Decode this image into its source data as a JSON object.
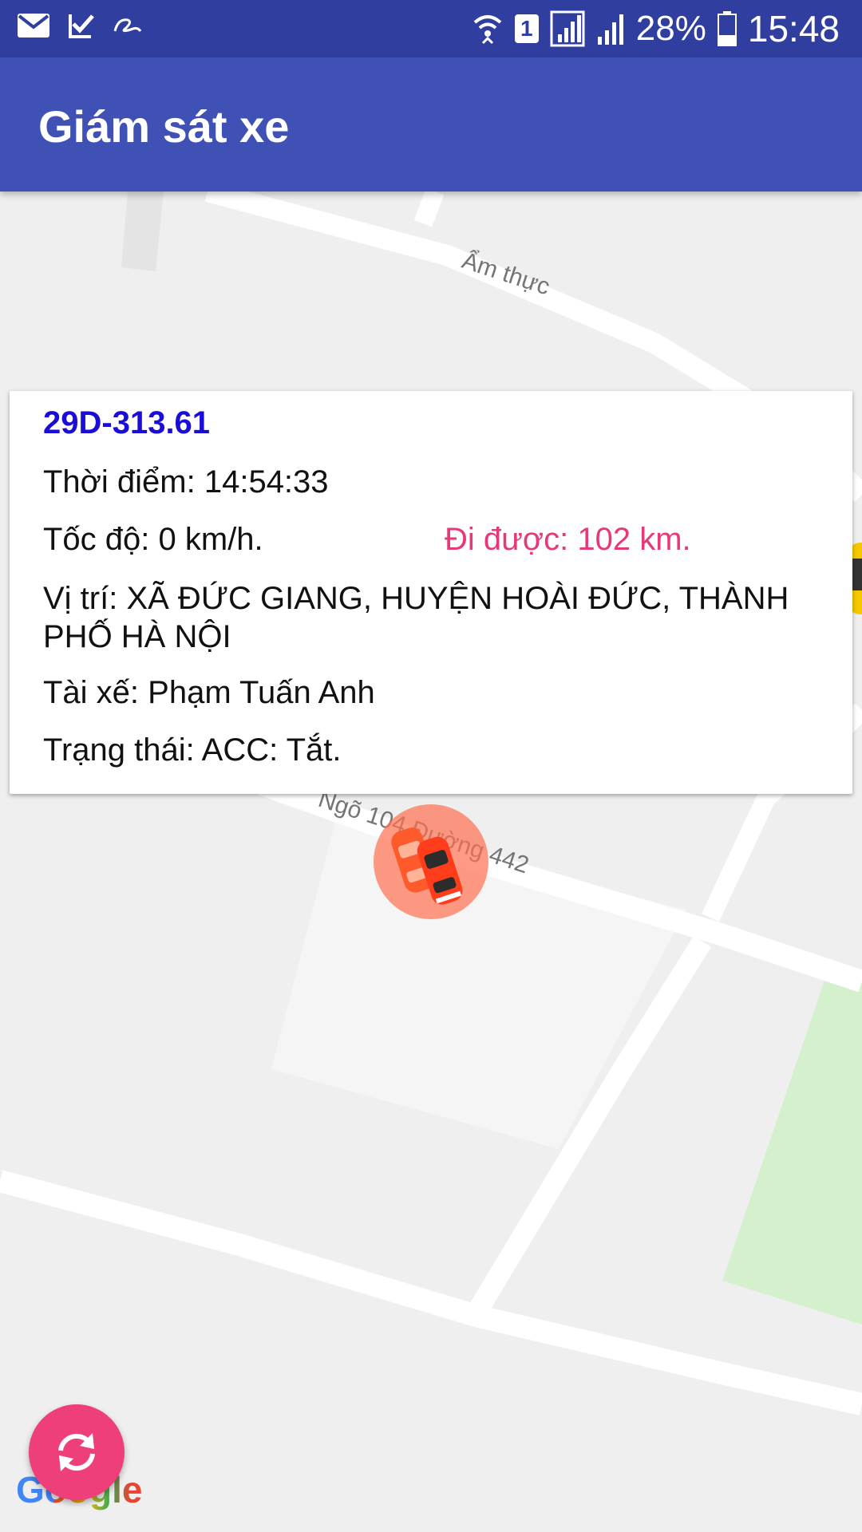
{
  "status_bar": {
    "battery_percent": "28%",
    "time": "15:48",
    "sim_number": "1",
    "icons": [
      "mail-icon",
      "task-check-icon",
      "app-notification-icon",
      "wifi-icon",
      "sim-badge-icon",
      "signal-1-icon",
      "signal-2-icon",
      "battery-icon"
    ]
  },
  "app_bar": {
    "title": "Giám sát xe"
  },
  "map": {
    "road_labels": {
      "top": "Ẩm thực",
      "middle": "Ngõ 104 Đường 442"
    },
    "colors": {
      "background": "#efefef",
      "road": "#ffffff",
      "park": "#d5f0cc"
    }
  },
  "vehicle": {
    "plate": "29D-313.61",
    "time_line": "Thời điểm: 14:54:33",
    "speed_line": "Tốc độ: 0 km/h.",
    "distance_line": "Đi được: 102 km.",
    "location_line": "Vị trí: XÃ ĐỨC GIANG, HUYỆN HOÀI ĐỨC, THÀNH PHỐ HÀ NỘI",
    "driver_line": "Tài xế: Phạm Tuấn Anh",
    "status_line": "Trạng thái: ACC: Tắt."
  },
  "fab": {
    "icon": "refresh-icon"
  },
  "branding": {
    "logo": "Google"
  },
  "accent": {
    "primary": "#3f51b5",
    "primary_dark": "#303f9f",
    "fab": "#ee3f7a",
    "plate": "#1a0dd6",
    "distance": "#e5397a"
  }
}
